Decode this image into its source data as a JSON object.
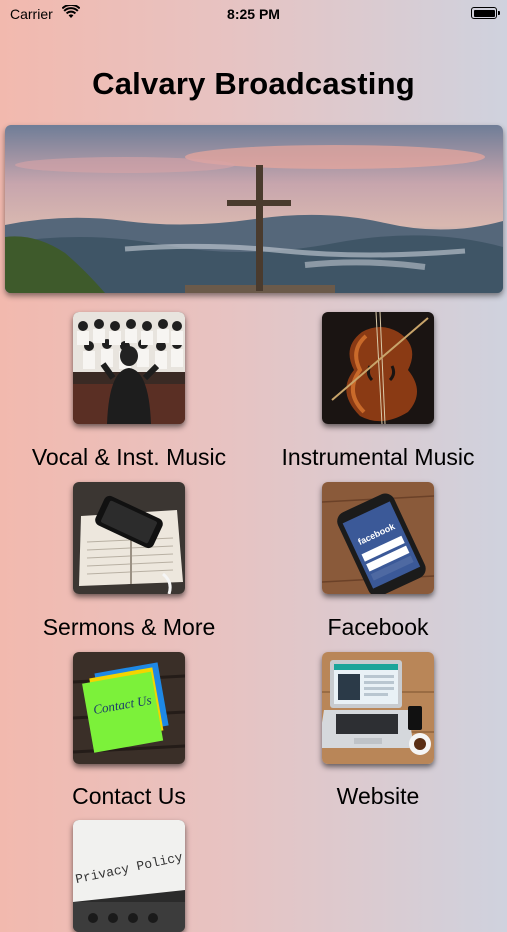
{
  "status_bar": {
    "carrier": "Carrier",
    "time": "8:25 PM",
    "battery_level": 1.0
  },
  "app": {
    "title": "Calvary Broadcasting",
    "banner_icon": "cross-landscape-image"
  },
  "menu": {
    "items": [
      {
        "label": "Vocal & Inst. Music",
        "icon": "choir-conductor-image"
      },
      {
        "label": "Instrumental Music",
        "icon": "cello-image"
      },
      {
        "label": "Sermons & More",
        "icon": "bible-phone-image"
      },
      {
        "label": "Facebook",
        "icon": "facebook-phone-image"
      },
      {
        "label": "Contact Us",
        "icon": "sticky-note-image"
      },
      {
        "label": "Website",
        "icon": "laptop-image"
      },
      {
        "label": "",
        "icon": "privacy-policy-image",
        "image_text": "Privacy Policy"
      }
    ]
  },
  "colors": {
    "background_left": "#f2b9ae",
    "background_right": "#cfd2de",
    "text": "#000000"
  }
}
